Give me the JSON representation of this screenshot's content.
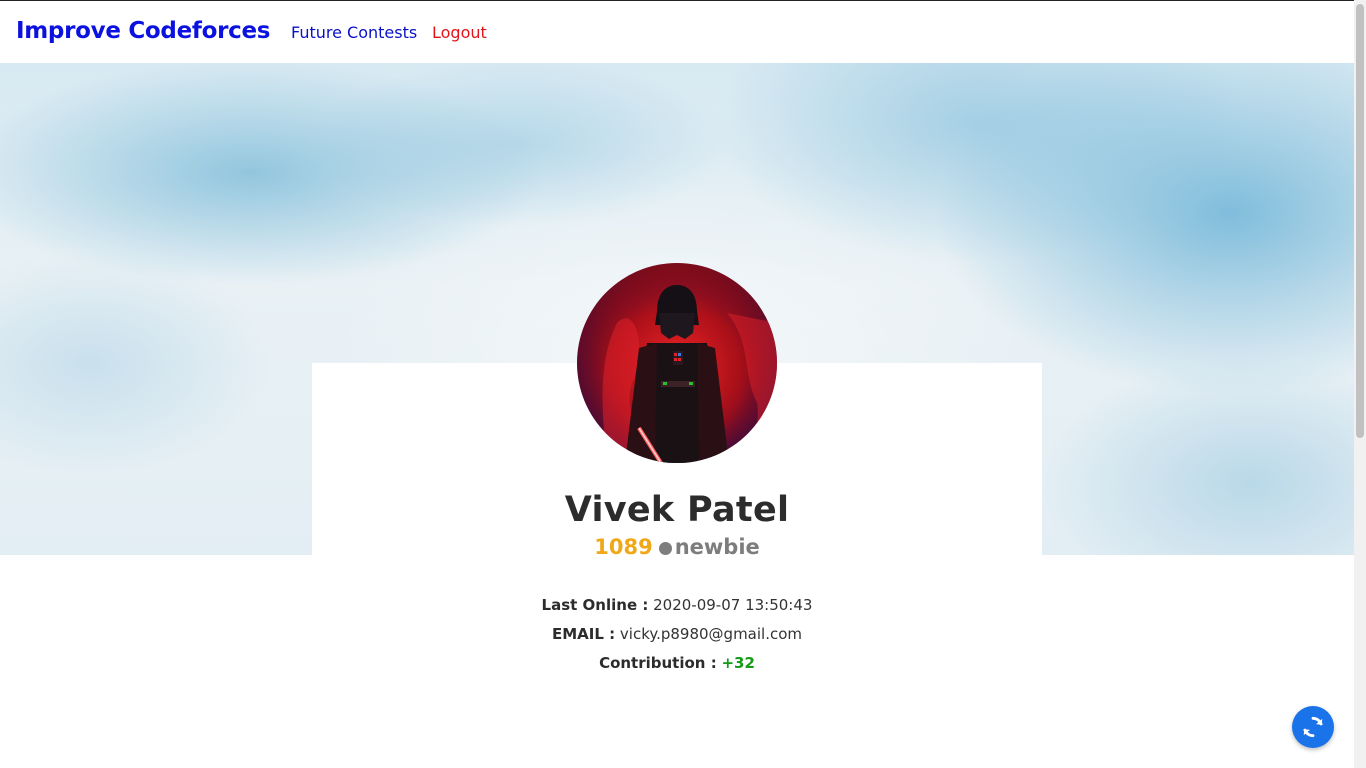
{
  "nav": {
    "brand": "Improve Codeforces",
    "links": [
      {
        "label": "Future Contests",
        "color": "#0a12c8"
      },
      {
        "label": "Logout",
        "color": "#e0141a"
      }
    ]
  },
  "profile": {
    "name": "Vivek Patel",
    "rating": "1089",
    "rank": "newbie",
    "rating_color": "#f0a818",
    "rank_color": "#7d7d7d",
    "avatar_icon": "darth-vader-avatar"
  },
  "details": {
    "last_online_label": "Last Online :",
    "last_online_value": "2020-09-07 13:50:43",
    "email_label": "EMAIL :",
    "email_value": "vicky.p8980@gmail.com",
    "contribution_label": "Contribution :",
    "contribution_value": "+32"
  },
  "fab": {
    "icon": "refresh-icon",
    "color": "#1a73e8"
  }
}
